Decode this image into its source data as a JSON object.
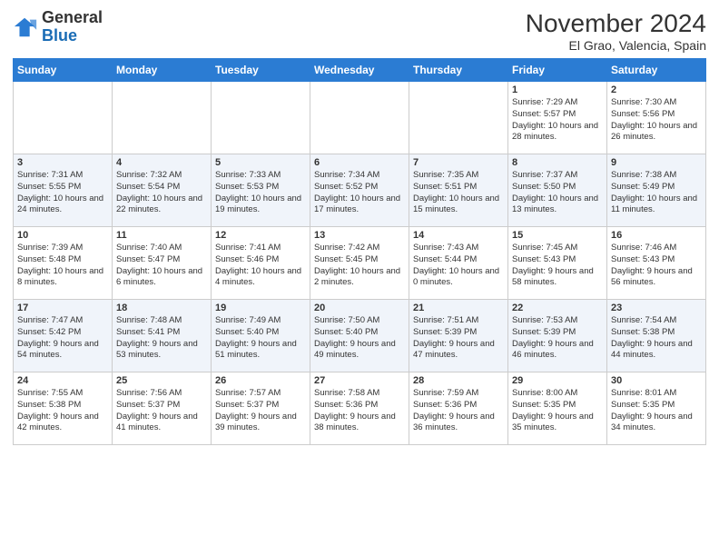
{
  "header": {
    "logo_general": "General",
    "logo_blue": "Blue",
    "month_title": "November 2024",
    "location": "El Grao, Valencia, Spain"
  },
  "weekdays": [
    "Sunday",
    "Monday",
    "Tuesday",
    "Wednesday",
    "Thursday",
    "Friday",
    "Saturday"
  ],
  "weeks": [
    [
      {
        "day": "",
        "info": ""
      },
      {
        "day": "",
        "info": ""
      },
      {
        "day": "",
        "info": ""
      },
      {
        "day": "",
        "info": ""
      },
      {
        "day": "",
        "info": ""
      },
      {
        "day": "1",
        "info": "Sunrise: 7:29 AM\nSunset: 5:57 PM\nDaylight: 10 hours and 28 minutes."
      },
      {
        "day": "2",
        "info": "Sunrise: 7:30 AM\nSunset: 5:56 PM\nDaylight: 10 hours and 26 minutes."
      }
    ],
    [
      {
        "day": "3",
        "info": "Sunrise: 7:31 AM\nSunset: 5:55 PM\nDaylight: 10 hours and 24 minutes."
      },
      {
        "day": "4",
        "info": "Sunrise: 7:32 AM\nSunset: 5:54 PM\nDaylight: 10 hours and 22 minutes."
      },
      {
        "day": "5",
        "info": "Sunrise: 7:33 AM\nSunset: 5:53 PM\nDaylight: 10 hours and 19 minutes."
      },
      {
        "day": "6",
        "info": "Sunrise: 7:34 AM\nSunset: 5:52 PM\nDaylight: 10 hours and 17 minutes."
      },
      {
        "day": "7",
        "info": "Sunrise: 7:35 AM\nSunset: 5:51 PM\nDaylight: 10 hours and 15 minutes."
      },
      {
        "day": "8",
        "info": "Sunrise: 7:37 AM\nSunset: 5:50 PM\nDaylight: 10 hours and 13 minutes."
      },
      {
        "day": "9",
        "info": "Sunrise: 7:38 AM\nSunset: 5:49 PM\nDaylight: 10 hours and 11 minutes."
      }
    ],
    [
      {
        "day": "10",
        "info": "Sunrise: 7:39 AM\nSunset: 5:48 PM\nDaylight: 10 hours and 8 minutes."
      },
      {
        "day": "11",
        "info": "Sunrise: 7:40 AM\nSunset: 5:47 PM\nDaylight: 10 hours and 6 minutes."
      },
      {
        "day": "12",
        "info": "Sunrise: 7:41 AM\nSunset: 5:46 PM\nDaylight: 10 hours and 4 minutes."
      },
      {
        "day": "13",
        "info": "Sunrise: 7:42 AM\nSunset: 5:45 PM\nDaylight: 10 hours and 2 minutes."
      },
      {
        "day": "14",
        "info": "Sunrise: 7:43 AM\nSunset: 5:44 PM\nDaylight: 10 hours and 0 minutes."
      },
      {
        "day": "15",
        "info": "Sunrise: 7:45 AM\nSunset: 5:43 PM\nDaylight: 9 hours and 58 minutes."
      },
      {
        "day": "16",
        "info": "Sunrise: 7:46 AM\nSunset: 5:43 PM\nDaylight: 9 hours and 56 minutes."
      }
    ],
    [
      {
        "day": "17",
        "info": "Sunrise: 7:47 AM\nSunset: 5:42 PM\nDaylight: 9 hours and 54 minutes."
      },
      {
        "day": "18",
        "info": "Sunrise: 7:48 AM\nSunset: 5:41 PM\nDaylight: 9 hours and 53 minutes."
      },
      {
        "day": "19",
        "info": "Sunrise: 7:49 AM\nSunset: 5:40 PM\nDaylight: 9 hours and 51 minutes."
      },
      {
        "day": "20",
        "info": "Sunrise: 7:50 AM\nSunset: 5:40 PM\nDaylight: 9 hours and 49 minutes."
      },
      {
        "day": "21",
        "info": "Sunrise: 7:51 AM\nSunset: 5:39 PM\nDaylight: 9 hours and 47 minutes."
      },
      {
        "day": "22",
        "info": "Sunrise: 7:53 AM\nSunset: 5:39 PM\nDaylight: 9 hours and 46 minutes."
      },
      {
        "day": "23",
        "info": "Sunrise: 7:54 AM\nSunset: 5:38 PM\nDaylight: 9 hours and 44 minutes."
      }
    ],
    [
      {
        "day": "24",
        "info": "Sunrise: 7:55 AM\nSunset: 5:38 PM\nDaylight: 9 hours and 42 minutes."
      },
      {
        "day": "25",
        "info": "Sunrise: 7:56 AM\nSunset: 5:37 PM\nDaylight: 9 hours and 41 minutes."
      },
      {
        "day": "26",
        "info": "Sunrise: 7:57 AM\nSunset: 5:37 PM\nDaylight: 9 hours and 39 minutes."
      },
      {
        "day": "27",
        "info": "Sunrise: 7:58 AM\nSunset: 5:36 PM\nDaylight: 9 hours and 38 minutes."
      },
      {
        "day": "28",
        "info": "Sunrise: 7:59 AM\nSunset: 5:36 PM\nDaylight: 9 hours and 36 minutes."
      },
      {
        "day": "29",
        "info": "Sunrise: 8:00 AM\nSunset: 5:35 PM\nDaylight: 9 hours and 35 minutes."
      },
      {
        "day": "30",
        "info": "Sunrise: 8:01 AM\nSunset: 5:35 PM\nDaylight: 9 hours and 34 minutes."
      }
    ]
  ]
}
